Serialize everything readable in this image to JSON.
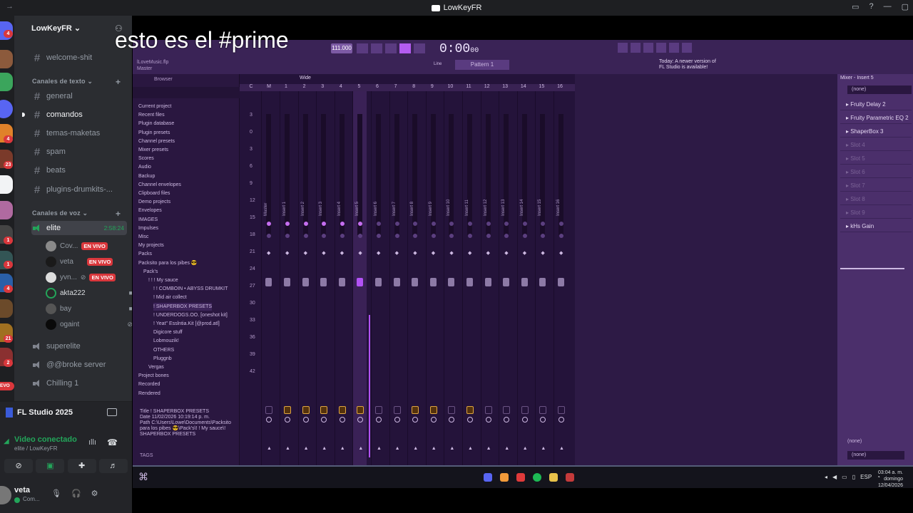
{
  "window": {
    "title": "LowKeyFR",
    "back_arrow": "→"
  },
  "rail": {
    "badges": [
      "4",
      "4",
      "23",
      "1",
      "1",
      "4",
      "21",
      "2"
    ],
    "new_label": "EVO"
  },
  "server": {
    "name": "LowKeyFR"
  },
  "channels": {
    "top": [
      {
        "name": "welcome-shit"
      }
    ],
    "text_category": "Canales de texto",
    "text": [
      {
        "name": "general"
      },
      {
        "name": "comandos"
      },
      {
        "name": "temas-maketas"
      },
      {
        "name": "spam"
      },
      {
        "name": "beats"
      },
      {
        "name": "plugins-drumkits-..."
      }
    ],
    "voice_category": "Canales de voz",
    "voice_active": {
      "name": "elite",
      "timer": "2:58:24"
    },
    "voice_users": [
      {
        "name": "Cov...",
        "live": "EN VIVO"
      },
      {
        "name": "veta",
        "live": "EN VIVO"
      },
      {
        "name": "yvn...",
        "live": "EN VIVO"
      },
      {
        "name": "akta222"
      },
      {
        "name": "bay"
      },
      {
        "name": "ogaint"
      }
    ],
    "voice_other": [
      {
        "name": "superelite"
      },
      {
        "name": "@@broke server"
      },
      {
        "name": "Chilling 1"
      }
    ]
  },
  "voice_panel": {
    "activity": "FL Studio 2025",
    "status": "Video conectado",
    "location": "elite / LowKeyFR",
    "user": "veta",
    "user_status": "Com..."
  },
  "overlay": {
    "text": "esto es el #prime"
  },
  "fl": {
    "file": "lLoveMusic.flp",
    "master": "Master",
    "time": "0:00",
    "time_sub": "00",
    "tempo": "111.000",
    "pattern": "Pattern 1",
    "line": "Line",
    "news_line1": "Today: A newer version of",
    "news_line2": "FL Studio is available!",
    "browser_title": "Browser",
    "wide": "Wide",
    "browser_items": [
      "Current project",
      "Recent files",
      "Plugin database",
      "Plugin presets",
      "Channel presets",
      "Mixer presets",
      "Scores",
      "Audio",
      "Backup",
      "Channel envelopes",
      "Clipboard files",
      "Demo projects",
      "Envelopes",
      "IMAGES",
      "Impulses",
      "Misc",
      "My projects",
      "Packs",
      "Packsito para los pibes 😎",
      "Pack's",
      "! ! ! My sauce",
      "! ! COMBOIN • ABYSS DRUMKIT",
      "! Mid air collect",
      "! SHAPERBOX PRESETS",
      "! UNDERDOGS.OO. [oneshot kit]",
      "! Yeat\" Esslntia.Kit [@prod.atl]",
      "Digicore stuff",
      "Lobmouzik!",
      "OTHERS",
      "Pluggnb",
      "Vergas",
      "Project bones",
      "Recorded",
      "Rendered"
    ],
    "info_title_k": "Title",
    "info_title_v": "! SHAPERBOX PRESETS",
    "info_date_k": "Date",
    "info_date_v": "11/02/2026 10:19:14 p. m.",
    "info_path_k": "Path",
    "info_path_v": "C:\\Users\\Lowe\\Documents\\Packsito para los pibes 😎\\Pack's\\! ! My sauce\\! SHAPERBOX PRESETS",
    "tags": "TAGS",
    "mixer_head": [
      "C",
      "M",
      "1",
      "2",
      "3",
      "4",
      "5",
      "6",
      "7",
      "8",
      "9",
      "10",
      "11",
      "12",
      "13",
      "14",
      "15",
      "16"
    ],
    "tracks": [
      "Master",
      "Insert 1",
      "Insert 2",
      "Insert 3",
      "Insert 4",
      "Insert 5",
      "Insert 6",
      "Insert 7",
      "Insert 8",
      "Insert 9",
      "Insert 10",
      "Insert 11",
      "Insert 12",
      "Insert 13",
      "Insert 14",
      "Insert 15",
      "Insert 16"
    ],
    "db_scale": [
      "3",
      "0",
      "3",
      "6",
      "9",
      "12",
      "15",
      "18",
      "21",
      "24",
      "27",
      "30",
      "33",
      "36",
      "39",
      "42"
    ],
    "mixer_panel_title": "Mixer - Insert 5",
    "none": "(none)",
    "fx": [
      {
        "name": "Fruity Delay 2",
        "on": true
      },
      {
        "name": "Fruity Parametric EQ 2",
        "on": true
      },
      {
        "name": "ShaperBox 3",
        "on": true
      },
      {
        "name": "Slot 4",
        "on": false
      },
      {
        "name": "Slot 5",
        "on": false
      },
      {
        "name": "Slot 6",
        "on": false
      },
      {
        "name": "Slot 7",
        "on": false
      },
      {
        "name": "Slot 8",
        "on": false
      },
      {
        "name": "Slot 9",
        "on": false
      },
      {
        "name": "kHs Gain",
        "on": true
      }
    ],
    "out_none_1": "(none)",
    "out_none_2": "(none)"
  },
  "taskbar": {
    "time": "03:04 a. m.",
    "day": "domingo",
    "date": "12/04/2026",
    "lang": "ESP"
  }
}
